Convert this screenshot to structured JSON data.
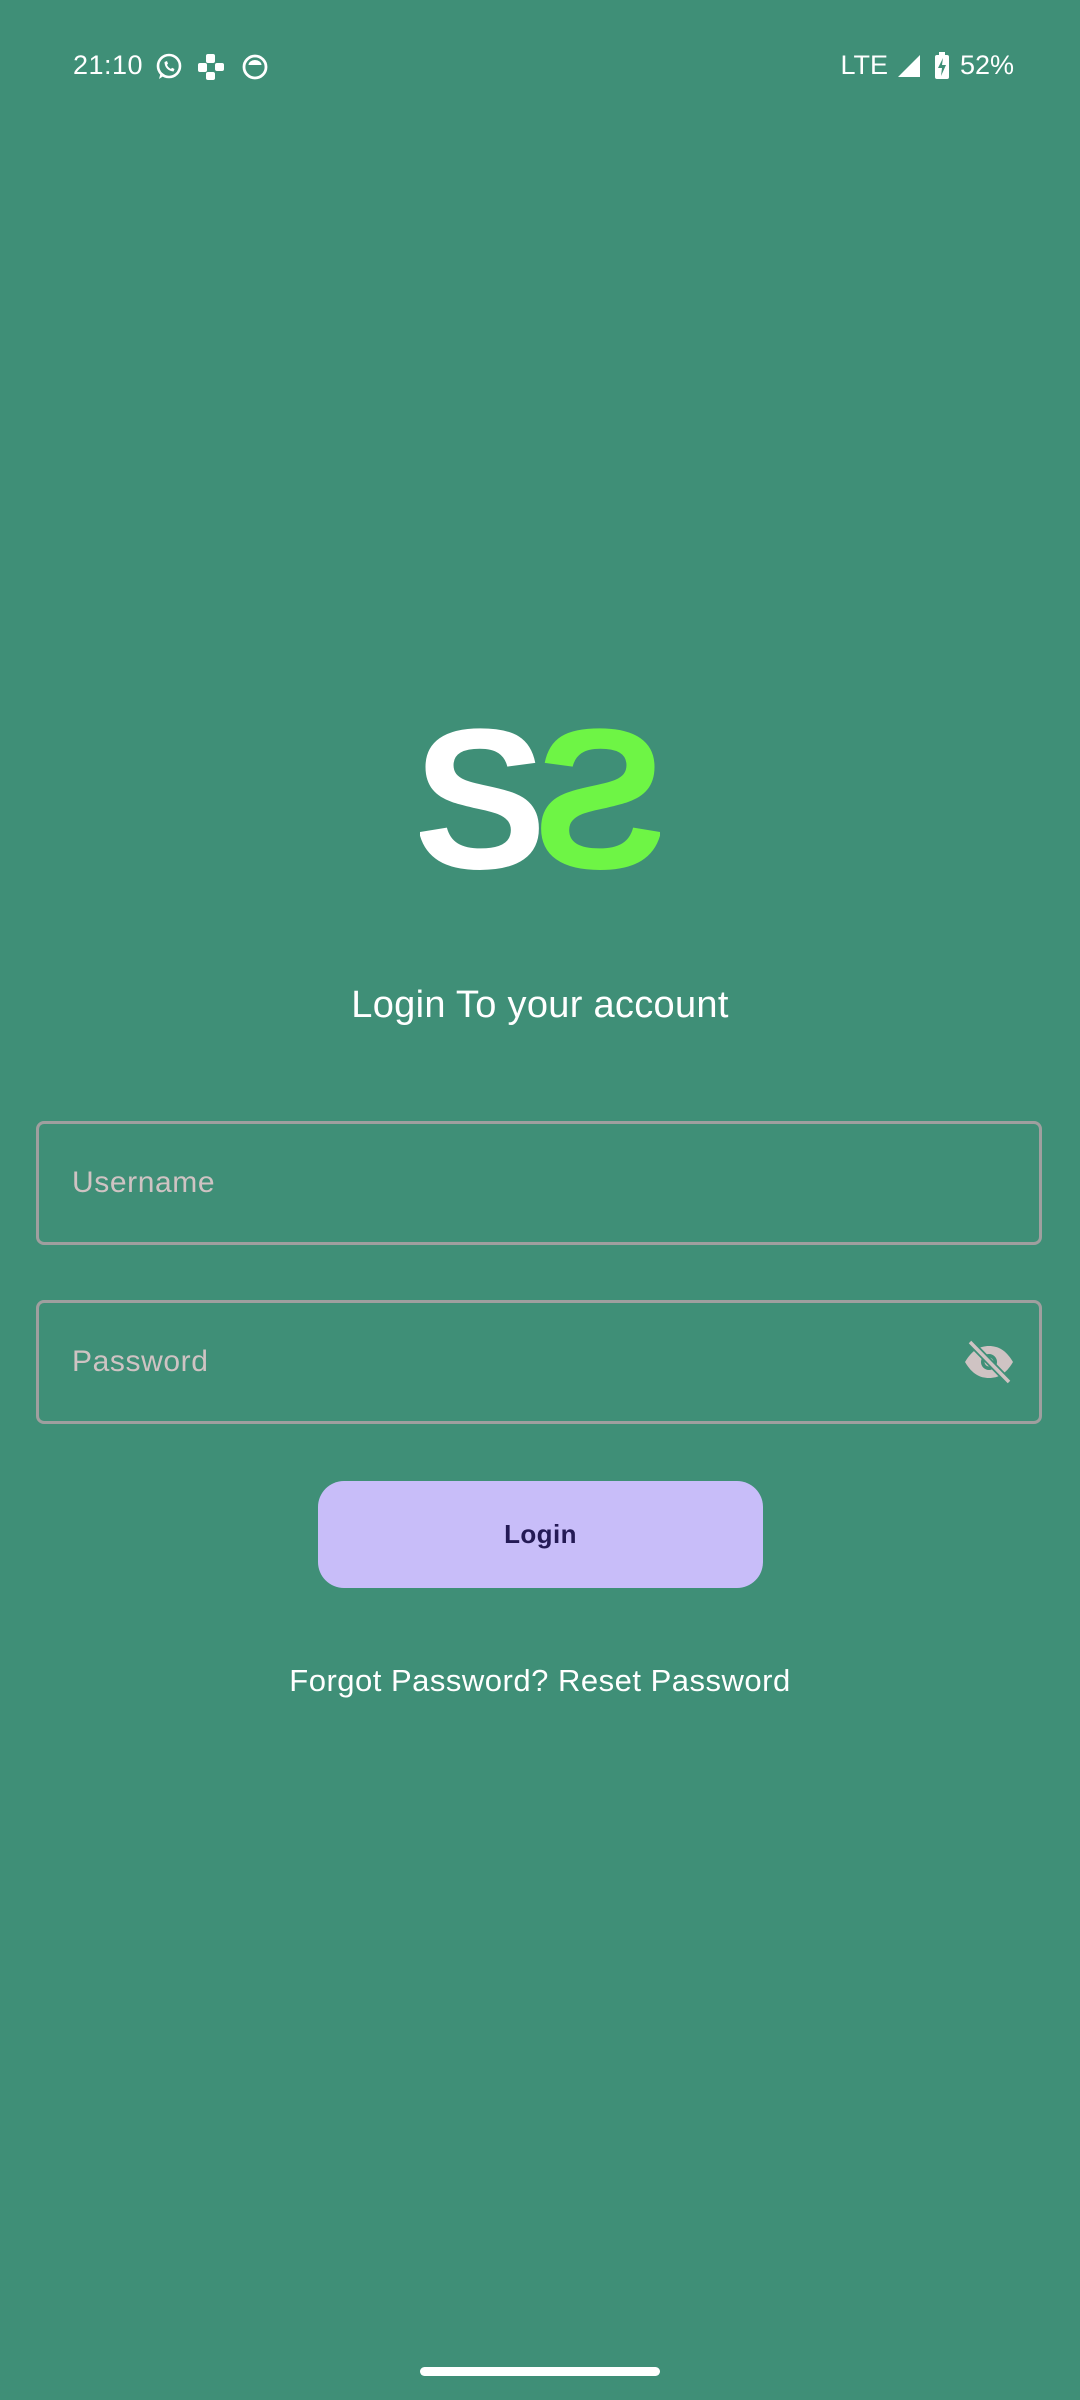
{
  "status_bar": {
    "time": "21:10",
    "network": "LTE",
    "battery": "52%",
    "notification_icons": [
      "whatsapp-icon",
      "music-icon",
      "app-icon"
    ]
  },
  "logo": {
    "letters": "SS",
    "colors": [
      "#ffffff",
      "#6ef545"
    ]
  },
  "login": {
    "title": "Login To your account",
    "username_placeholder": "Username",
    "password_placeholder": "Password",
    "button_label": "Login",
    "forgot_text": "Forgot Password?",
    "reset_link": "Reset Password"
  },
  "colors": {
    "background": "#3f8f77",
    "button": "#c8bdf9",
    "button_text": "#241a55",
    "accent_green": "#6ef545"
  }
}
